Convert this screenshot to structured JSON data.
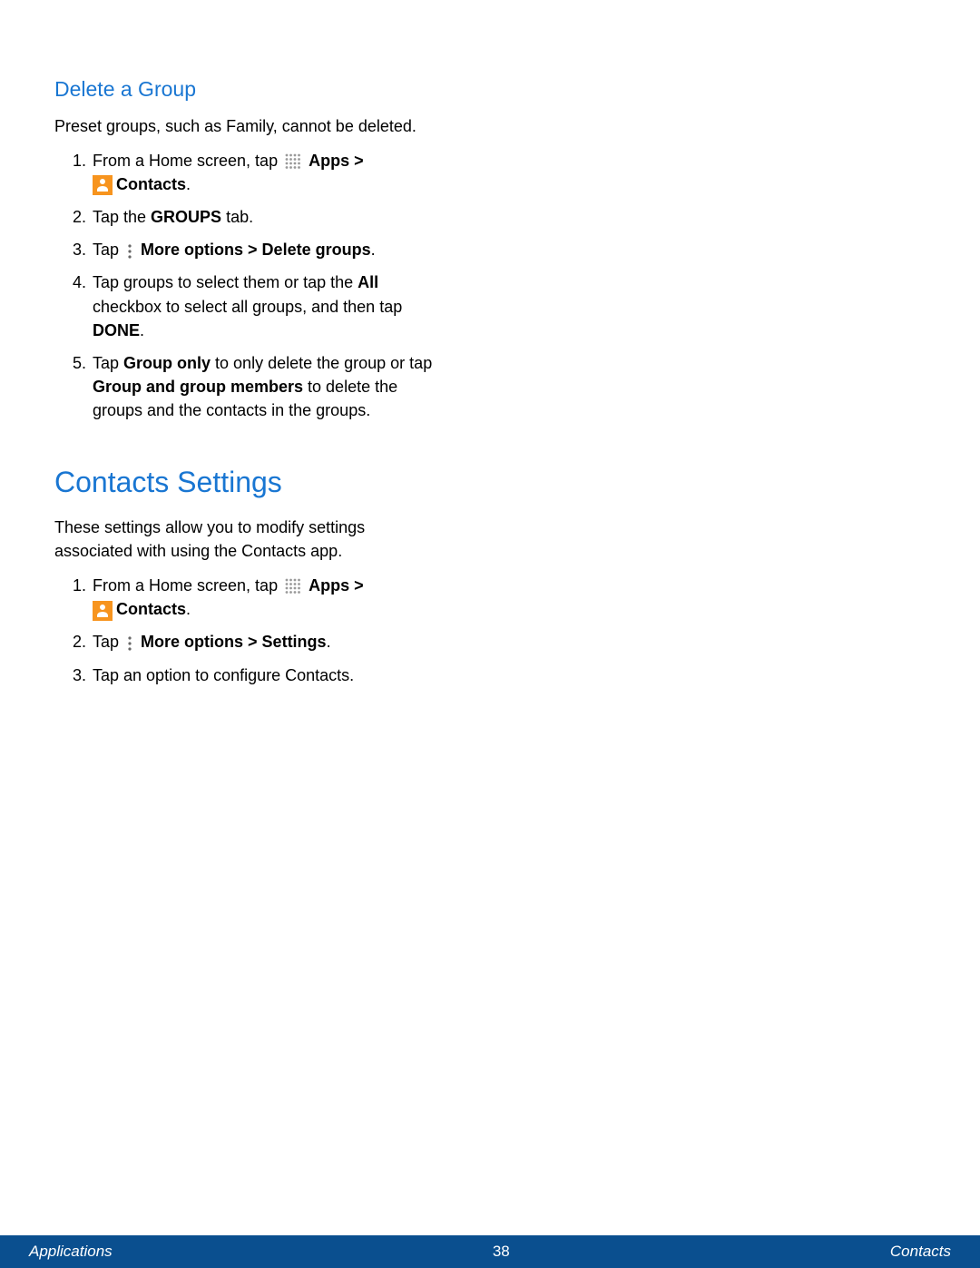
{
  "section1": {
    "heading": "Delete a Group",
    "intro": "Preset groups, such as Family, cannot be deleted.",
    "steps": {
      "s1_a": "From a Home screen, tap ",
      "s1_apps": "Apps",
      "s1_gt": " > ",
      "s1_contacts": "Contacts",
      "s1_period": ".",
      "s2_a": "Tap the ",
      "s2_groups": "GROUPS",
      "s2_b": " tab.",
      "s3_a": "Tap ",
      "s3_b": "More options > Delete groups",
      "s3_c": ".",
      "s4_a": "Tap groups to select them or tap the ",
      "s4_all": "All",
      "s4_b": " checkbox to select all groups, and then tap ",
      "s4_done": "DONE",
      "s4_c": ".",
      "s5_a": "Tap ",
      "s5_go": "Group only",
      "s5_b": " to only delete the group or tap ",
      "s5_ggm": "Group and group members",
      "s5_c": " to delete the groups and the contacts in the groups."
    }
  },
  "section2": {
    "heading": "Contacts Settings",
    "intro": "These settings allow you to modify settings associated with using the Contacts app.",
    "steps": {
      "s1_a": "From a Home screen, tap ",
      "s1_apps": "Apps",
      "s1_gt": " > ",
      "s1_contacts": "Contacts",
      "s1_period": ".",
      "s2_a": "Tap ",
      "s2_b": "More options > Settings",
      "s2_c": ".",
      "s3": "Tap an option to configure Contacts."
    }
  },
  "footer": {
    "left": "Applications",
    "center": "38",
    "right": "Contacts"
  }
}
